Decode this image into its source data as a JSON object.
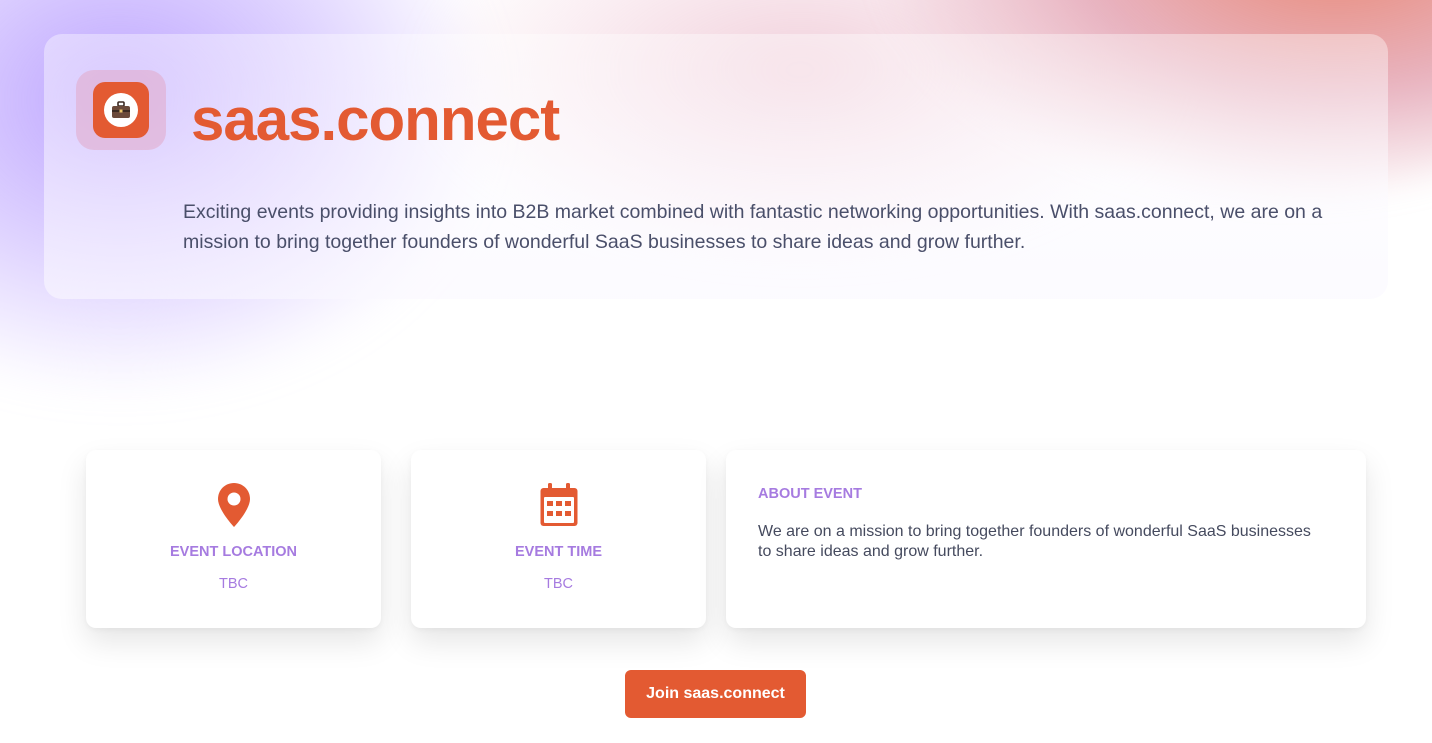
{
  "brand": {
    "name": "saas.connect",
    "logo_icon": "briefcase-icon",
    "accent_color": "#e35a32"
  },
  "hero": {
    "intro": "Exciting events providing insights into B2B market combined with fantastic networking opportunities. With saas.connect, we are on a mission to bring together founders of wonderful SaaS businesses to share ideas and grow further."
  },
  "cards": {
    "location": {
      "icon": "map-pin-icon",
      "label": "EVENT LOCATION",
      "value": "TBC"
    },
    "time": {
      "icon": "calendar-icon",
      "label": "EVENT TIME",
      "value": "TBC"
    },
    "about": {
      "title": "ABOUT EVENT",
      "text": "We are on a mission to bring together founders of wonderful SaaS businesses to share ideas and grow further."
    }
  },
  "cta": {
    "label": "Join saas.connect"
  },
  "colors": {
    "label_purple": "#a67be0",
    "body_text": "#4a4f6a"
  }
}
